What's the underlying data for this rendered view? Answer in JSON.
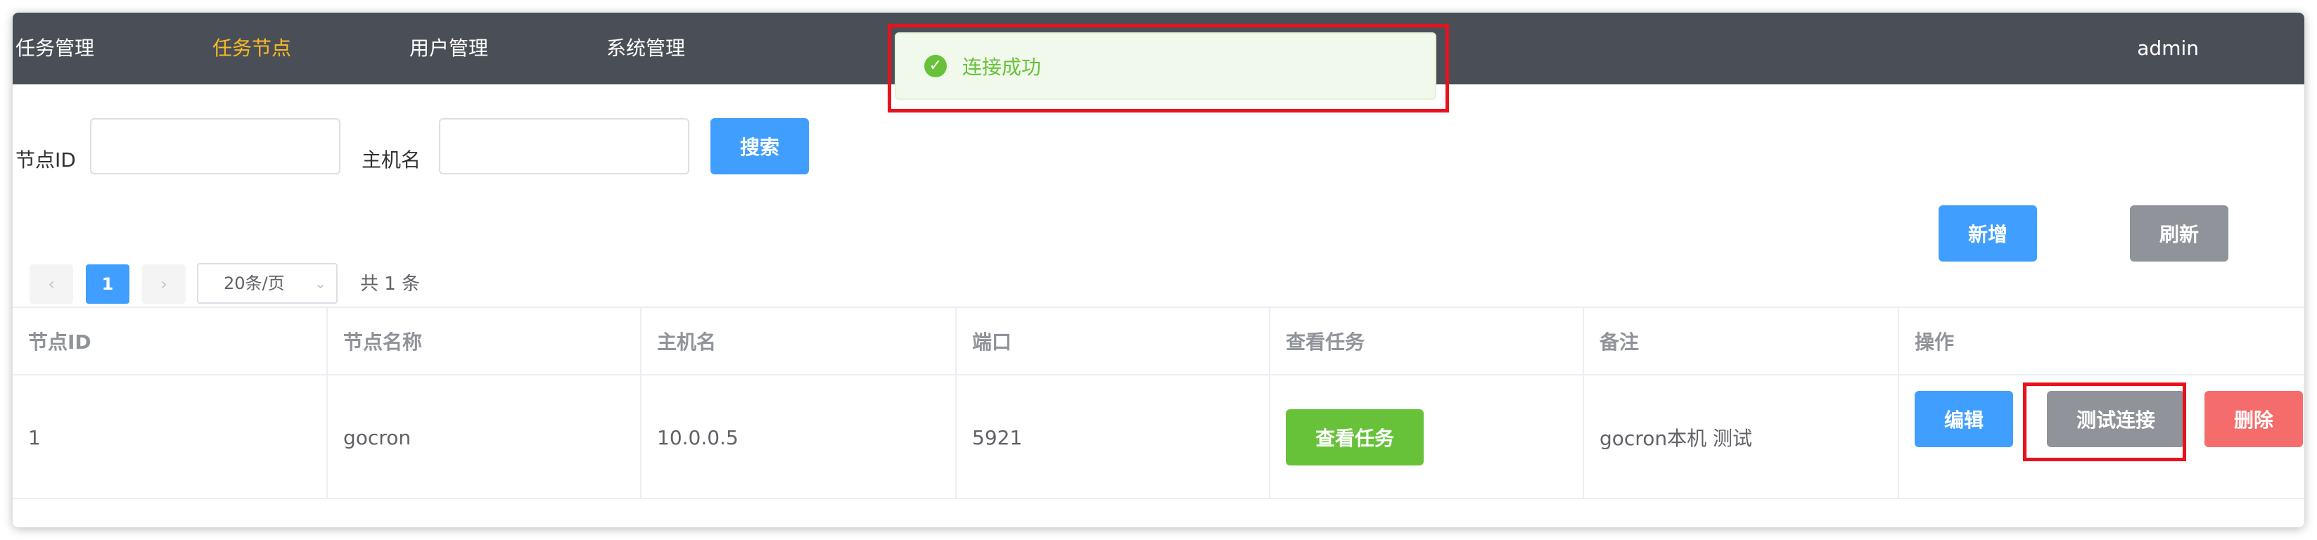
{
  "nav": {
    "items": [
      {
        "label": "任务管理",
        "active": false
      },
      {
        "label": "任务节点",
        "active": true
      },
      {
        "label": "用户管理",
        "active": false
      },
      {
        "label": "系统管理",
        "active": false
      }
    ],
    "user": "admin"
  },
  "search": {
    "node_id_label": "节点ID",
    "node_id_value": "",
    "hostname_label": "主机名",
    "hostname_value": "",
    "search_button": "搜索"
  },
  "actions": {
    "add_button": "新增",
    "refresh_button": "刷新"
  },
  "pagination": {
    "prev_icon": "chevron-left-icon",
    "current_page": "1",
    "next_icon": "chevron-right-icon",
    "page_size": "20条/页",
    "total": "共 1 条"
  },
  "table": {
    "headers": [
      "节点ID",
      "节点名称",
      "主机名",
      "端口",
      "查看任务",
      "备注",
      "操作"
    ],
    "rows": [
      {
        "id": "1",
        "name": "gocron",
        "hostname": "10.0.0.5",
        "port": "5921",
        "view_tasks_button": "查看任务",
        "remark": "gocron本机 测试",
        "edit_button": "编辑",
        "test_button": "测试连接",
        "delete_button": "删除"
      }
    ]
  },
  "toast": {
    "message": "连接成功",
    "icon": "success-check-icon"
  },
  "colors": {
    "nav_bg": "#4a4f57",
    "nav_active": "#f7ba2a",
    "primary": "#409eff",
    "info": "#909399",
    "success": "#67c23a",
    "danger": "#f56c6c",
    "highlight": "#e8121d"
  }
}
